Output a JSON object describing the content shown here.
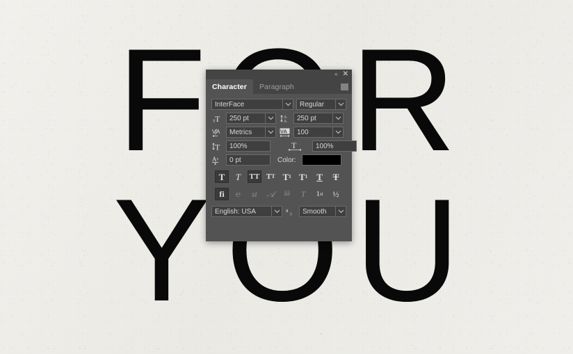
{
  "poster": {
    "line1": "FOR",
    "line2": "YOU",
    "text_color": "#090909",
    "background_color": "#efeeea"
  },
  "panel": {
    "titlebar": {
      "collapse_icon": "collapse-double-chevron-icon",
      "collapse_glyph": "«",
      "close_icon": "close-icon",
      "close_glyph": "✕"
    },
    "tabs": [
      {
        "label": "Character",
        "active": true
      },
      {
        "label": "Paragraph",
        "active": false
      }
    ],
    "menu_icon": "panel-menu-icon",
    "font": {
      "family_value": "InterFace",
      "style_value": "Regular"
    },
    "metrics": {
      "font_size_icon": "font-size-icon",
      "font_size_value": "250 pt",
      "leading_icon": "leading-icon",
      "leading_value": "250 pt",
      "kerning_icon": "kerning-icon",
      "kerning_value": "Metrics",
      "tracking_icon": "tracking-icon",
      "tracking_value": "100",
      "vertical_scale_icon": "vertical-scale-icon",
      "vertical_scale_value": "100%",
      "horizontal_scale_icon": "horizontal-scale-icon",
      "horizontal_scale_value": "100%",
      "baseline_shift_icon": "baseline-shift-icon",
      "baseline_shift_value": "0 pt",
      "color_label": "Color:",
      "color_value": "#000000"
    },
    "style_buttons": [
      {
        "name": "faux-bold-button",
        "glyph": "T",
        "variant": "bold",
        "active": false,
        "dim": false
      },
      {
        "name": "faux-italic-button",
        "glyph": "T",
        "variant": "italic",
        "active": false,
        "dim": false
      },
      {
        "name": "all-caps-button",
        "glyph": "TT",
        "variant": "allcaps",
        "active": true,
        "dim": false
      },
      {
        "name": "small-caps-button",
        "glyph": "T",
        "variant": "smallcaps",
        "active": false,
        "dim": false
      },
      {
        "name": "superscript-button",
        "glyph": "T",
        "variant": "superscript",
        "active": false,
        "dim": false
      },
      {
        "name": "subscript-button",
        "glyph": "T",
        "variant": "subscript",
        "active": false,
        "dim": false
      },
      {
        "name": "underline-button",
        "glyph": "T",
        "variant": "underline",
        "active": false,
        "dim": false
      },
      {
        "name": "strikethrough-button",
        "glyph": "T",
        "variant": "strike",
        "active": false,
        "dim": false
      }
    ],
    "opentype_buttons": [
      {
        "name": "standard-ligatures-button",
        "glyph": "fi",
        "variant": "plain",
        "active": true,
        "dim": false
      },
      {
        "name": "contextual-alternates-button",
        "glyph": "℘",
        "variant": "swash",
        "active": false,
        "dim": true
      },
      {
        "name": "discretionary-ligatures-button",
        "glyph": "st",
        "variant": "plain",
        "active": false,
        "dim": true
      },
      {
        "name": "swash-button",
        "glyph": "ᴬ",
        "variant": "script",
        "active": false,
        "dim": true
      },
      {
        "name": "stylistic-alternates-button",
        "glyph": "aa",
        "variant": "arrow",
        "active": false,
        "dim": true
      },
      {
        "name": "titling-alternates-button",
        "glyph": "T",
        "variant": "italic",
        "active": false,
        "dim": true
      },
      {
        "name": "ordinals-button",
        "glyph": "1",
        "variant": "ordinal",
        "active": false,
        "dim": false
      },
      {
        "name": "fractions-button",
        "glyph": "½",
        "variant": "plain",
        "active": false,
        "dim": false
      }
    ],
    "bottom": {
      "language_value": "English: USA",
      "antialias_icon": "anti-alias-icon",
      "antialias_value": "Smooth"
    }
  }
}
